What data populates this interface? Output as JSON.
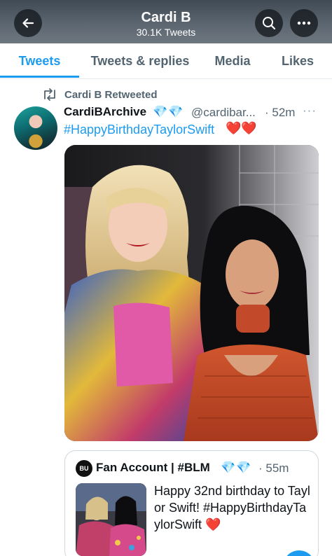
{
  "header": {
    "title": "Cardi B",
    "subtitle": "30.1K Tweets",
    "icons": {
      "back": "arrow-left-icon",
      "search": "search-icon",
      "more": "more-horizontal-icon"
    },
    "gradient": [
      "#3f4a54",
      "#6e7780"
    ]
  },
  "tabs": [
    {
      "label": "Tweets",
      "active": true
    },
    {
      "label": "Tweets & replies",
      "active": false
    },
    {
      "label": "Media",
      "active": false
    },
    {
      "label": "Likes",
      "active": false
    }
  ],
  "tweet": {
    "retweet_label": "Cardi B Retweeted",
    "author_name": "CardiBArchive",
    "author_badges": "💎💎",
    "handle": "@cardibar...",
    "time": "· 52m",
    "more": "···",
    "text": "#HappyBirthdayTaylorSwift",
    "hearts": "❤️❤️",
    "media": "photo",
    "accent": "#1d9bf0"
  },
  "quote": {
    "avatar_label": "BU",
    "author_name": "Fan Account | #BLM",
    "author_badges": "💎💎",
    "time": "· 55m",
    "text": "Happy 32nd birthday to Taylor Swift! #HappyBirthdayTaylorSwift",
    "heart": "❤️"
  },
  "colors": {
    "accent": "#1d9bf0",
    "secondary_text": "#536471",
    "primary_text": "#0f1419",
    "heart": "#e0245e"
  }
}
